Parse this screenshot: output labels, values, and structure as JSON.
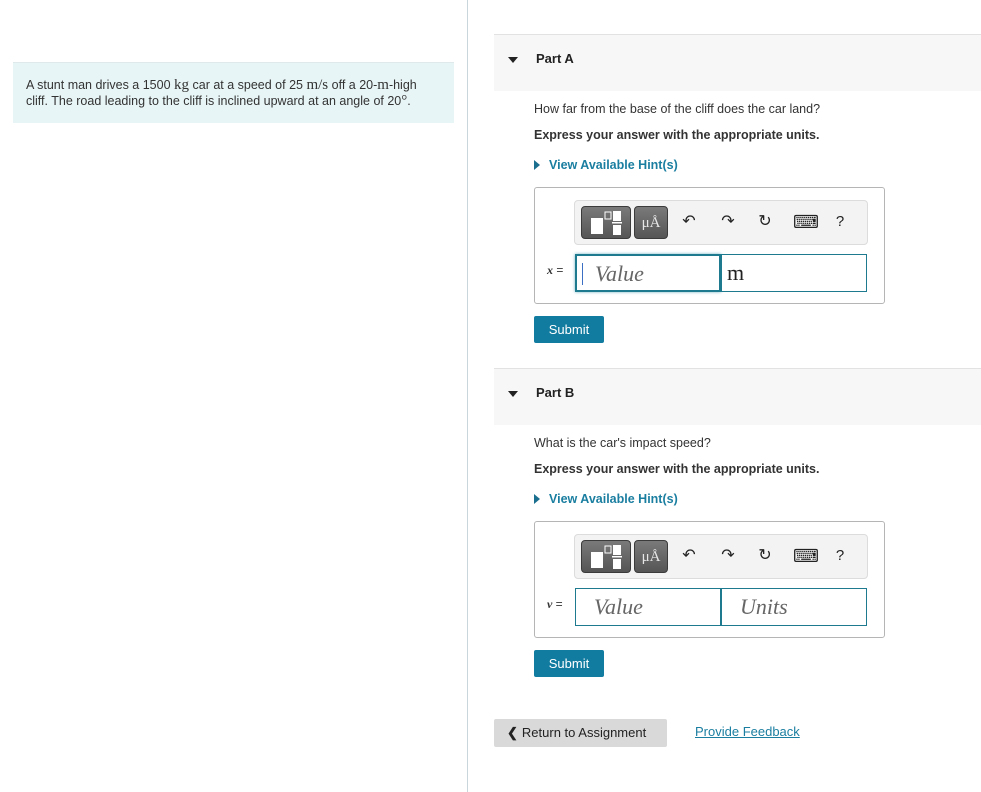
{
  "problem": {
    "text_parts": [
      "A stunt man drives a 1500 ",
      "kg",
      " car at a speed of 25 ",
      "m/s",
      " off a 20-",
      "m",
      "-high cliff. The road leading to the cliff is inclined upward at an angle of 20",
      "°",
      "."
    ]
  },
  "parts": [
    {
      "title": "Part A",
      "question": "How far from the base of the cliff does the car land?",
      "instruction": "Express your answer with the appropriate units.",
      "hint_label": "View Available Hint(s)",
      "toolbar": {
        "templates_icon": "templates-icon",
        "units_label": "μÅ",
        "undo": "↶",
        "redo": "↷",
        "reset": "↻",
        "keyboard": "⌨",
        "help": "?"
      },
      "variable": "x",
      "equals": " =",
      "value_placeholder": "Value",
      "value": "",
      "units_value": "m",
      "units_placeholder": "Units",
      "submit_label": "Submit"
    },
    {
      "title": "Part B",
      "question": "What is the car's impact speed?",
      "instruction": "Express your answer with the appropriate units.",
      "hint_label": "View Available Hint(s)",
      "toolbar": {
        "templates_icon": "templates-icon",
        "units_label": "μÅ",
        "undo": "↶",
        "redo": "↷",
        "reset": "↻",
        "keyboard": "⌨",
        "help": "?"
      },
      "variable": "v",
      "equals": " =",
      "value_placeholder": "Value",
      "value": "",
      "units_value": "",
      "units_placeholder": "Units",
      "submit_label": "Submit"
    }
  ],
  "footer": {
    "return_label": "Return to Assignment",
    "feedback_label": "Provide Feedback"
  },
  "colors": {
    "accent": "#127ca0",
    "link": "#1a7ea0",
    "problem_bg": "#e8f5f6",
    "part_header_bg": "#f7f7f7"
  }
}
